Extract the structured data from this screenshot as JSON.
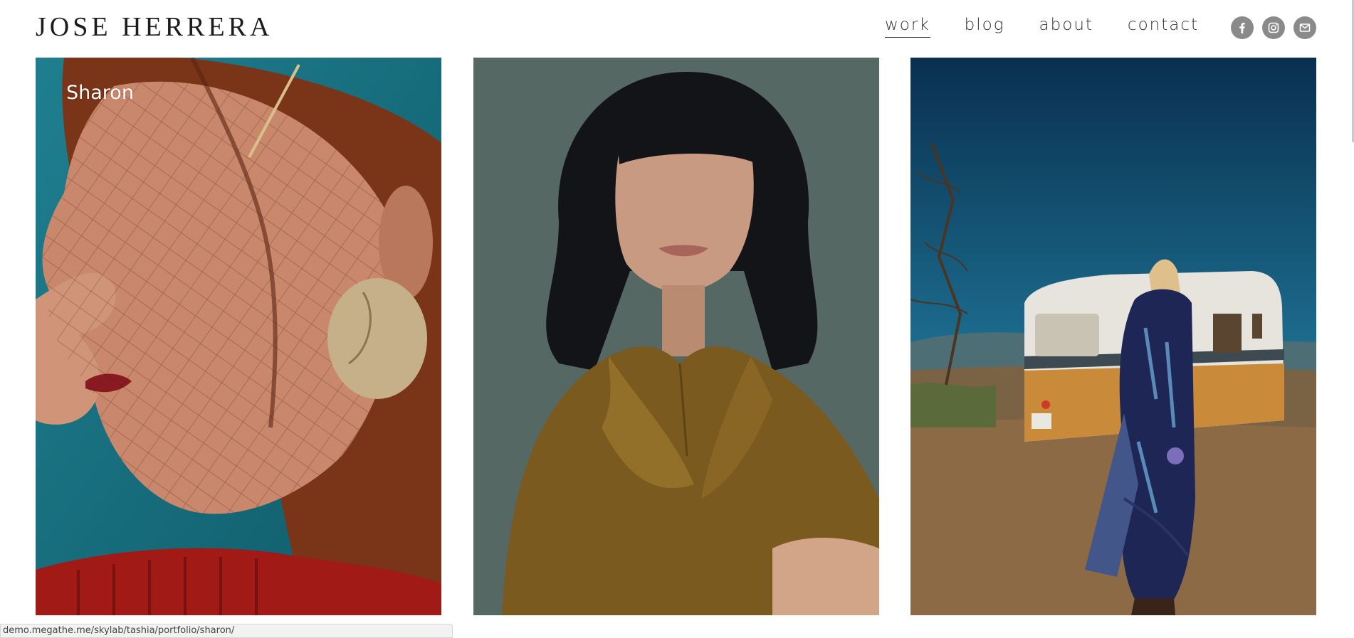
{
  "header": {
    "logo": "JOSE HERRERA",
    "nav": [
      {
        "label": "work",
        "active": true
      },
      {
        "label": "blog",
        "active": false
      },
      {
        "label": "about",
        "active": false
      },
      {
        "label": "contact",
        "active": false
      }
    ],
    "social": [
      "facebook-icon",
      "instagram-icon",
      "mail-icon"
    ]
  },
  "portfolio": {
    "items": [
      {
        "title": "Sharon"
      },
      {
        "title": ""
      },
      {
        "title": ""
      }
    ]
  },
  "status_bar": {
    "url": "demo.megathe.me/skylab/tashia/portfolio/sharon/"
  },
  "colors": {
    "social_bg": "#8a8a8a",
    "text_dark": "#1c1c1c"
  }
}
